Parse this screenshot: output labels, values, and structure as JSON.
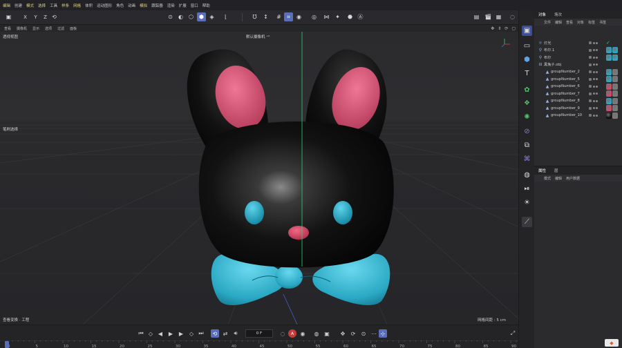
{
  "menu": {
    "items": [
      "编辑",
      "创建",
      "模式",
      "选择",
      "工具",
      "样条",
      "网格",
      "体积",
      "运动图形",
      "角色",
      "动画",
      "模拟",
      "跟踪器",
      "渲染",
      "扩展",
      "窗口",
      "帮助"
    ],
    "highlight_index": 3
  },
  "toolbar": {
    "axis_x": "X",
    "axis_y": "Y",
    "axis_z": "Z",
    "icons": [
      "cube-icon",
      "arrow-undo-icon",
      "move-icon",
      "rotate-icon",
      "scale-icon",
      "play-icon",
      "record-icon",
      "stop-icon",
      "cube-mode-icon",
      "grid-icon",
      "snap-icon",
      "target-icon",
      "butterfly-icon",
      "camera-icon",
      "render-icon",
      "render-settings-icon",
      "render-region-icon",
      "render-view-icon",
      "clapper-icon",
      "film-icon",
      "settings-icon",
      "clock-icon"
    ]
  },
  "viewport": {
    "menu": [
      "查看",
      "摄像机",
      "显示",
      "选项",
      "过滤",
      "面板"
    ],
    "title": "透视视图",
    "camera": "默认摄像机 ⁺⁰",
    "side_label": "笔刷选择",
    "footer_left": "查看变换 · 工程",
    "grid_info": "网格间距 : 5 cm"
  },
  "timeline": {
    "frame": "0 F",
    "ruler": [
      "0",
      "5",
      "10",
      "15",
      "20",
      "25",
      "30",
      "35",
      "40",
      "45",
      "50",
      "55",
      "60",
      "65",
      "70",
      "75",
      "80",
      "85",
      "90"
    ]
  },
  "object_manager": {
    "tabs": [
      "对象",
      "场次"
    ],
    "menu": [
      "文件",
      "编辑",
      "查看",
      "对象",
      "标签",
      "书签"
    ],
    "rows": [
      {
        "name": "灯光",
        "indent": 0,
        "icon": "light-icon",
        "tags": [
          "check"
        ]
      },
      {
        "name": "布尔.1",
        "indent": 0,
        "icon": "boolean-icon",
        "tags": [
          "blue",
          "blue"
        ]
      },
      {
        "name": "布尔",
        "indent": 0,
        "icon": "boolean-icon",
        "tags": [
          "blue",
          "blue"
        ]
      },
      {
        "name": "黑兔子.obj",
        "indent": 0,
        "icon": "group-icon",
        "tags": []
      },
      {
        "name": "groupNumber_2",
        "indent": 1,
        "icon": "polygon-icon",
        "tags": [
          "blue",
          "gray"
        ]
      },
      {
        "name": "groupNumber_5",
        "indent": 1,
        "icon": "polygon-icon",
        "tags": [
          "blue",
          "gray"
        ]
      },
      {
        "name": "groupNumber_6",
        "indent": 1,
        "icon": "polygon-icon",
        "tags": [
          "pink",
          "gray"
        ]
      },
      {
        "name": "groupNumber_7",
        "indent": 1,
        "icon": "polygon-icon",
        "tags": [
          "pink",
          "gray"
        ]
      },
      {
        "name": "groupNumber_8",
        "indent": 1,
        "icon": "polygon-icon",
        "tags": [
          "blue",
          "gray"
        ]
      },
      {
        "name": "groupNumber_9",
        "indent": 1,
        "icon": "polygon-icon",
        "tags": [
          "pink",
          "gray"
        ]
      },
      {
        "name": "groupNumber_10",
        "indent": 1,
        "icon": "polygon-icon",
        "tags": [
          "black",
          "gray"
        ]
      }
    ]
  },
  "attributes": {
    "tabs": [
      "属性",
      "层"
    ],
    "menu": [
      "模式",
      "编辑",
      "用户数据"
    ]
  },
  "colors": {
    "accent": "#5a6fb8",
    "tag_blue": "#2aa8c4",
    "tag_pink": "#d24a6a",
    "tag_black": "#111111",
    "tag_gray": "#7a7a7a",
    "check": "#4cc36a"
  }
}
